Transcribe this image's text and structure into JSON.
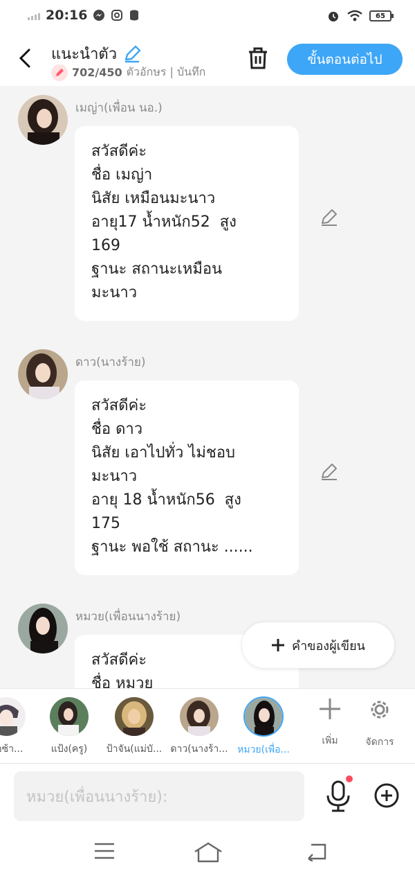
{
  "status": {
    "time": "20:16",
    "battery": "65"
  },
  "header": {
    "title": "แนะนำตัว",
    "count": "702/450",
    "count_suffix": "ตัวอักษร | บันทึก",
    "next_label": "ขั้นตอนต่อไป"
  },
  "messages": [
    {
      "name": "เมญ่า(เพื่อน นอ.)",
      "text": "สวัสดีค่ะ\nชื่อ เมญ่า\nนิสัย เหมือนมะนาว\nอายุ17 น้ำหนัก52  สูง\n169\nฐานะ สถานะเหมือน\nมะนาว"
    },
    {
      "name": "ดาว(นางร้าย)",
      "text": "สวัสดีค่ะ\nชื่อ ดาว\nนิสัย เอาไปทั่ว ไม่ชอบ\nมะนาว\nอายุ 18 น้ำหนัก56  สูง\n175\nฐานะ พอใช้ สถานะ ......"
    },
    {
      "name": "หมวย(เพื่อนนางร้าย)",
      "text": "สวัสดีค่ะ\nชื่อ หมวย"
    }
  ],
  "author_button": "คำของผู้เขียน",
  "characters": [
    {
      "label": "ชื่อซ้า..."
    },
    {
      "label": "แป้ง(ครู)"
    },
    {
      "label": "ป้าจัน(แม่บั..."
    },
    {
      "label": "ดาว(นางร้า..."
    },
    {
      "label": "หมวย(เพื่อ..."
    }
  ],
  "tools": {
    "add_label": "เพิ่ม",
    "manage_label": "จัดการ"
  },
  "input": {
    "placeholder": "หมวย(เพื่อนนางร้าย):"
  },
  "colors": {
    "accent": "#3ea6f6",
    "background": "#f4f4f4",
    "dot": "#ff4b5c"
  }
}
